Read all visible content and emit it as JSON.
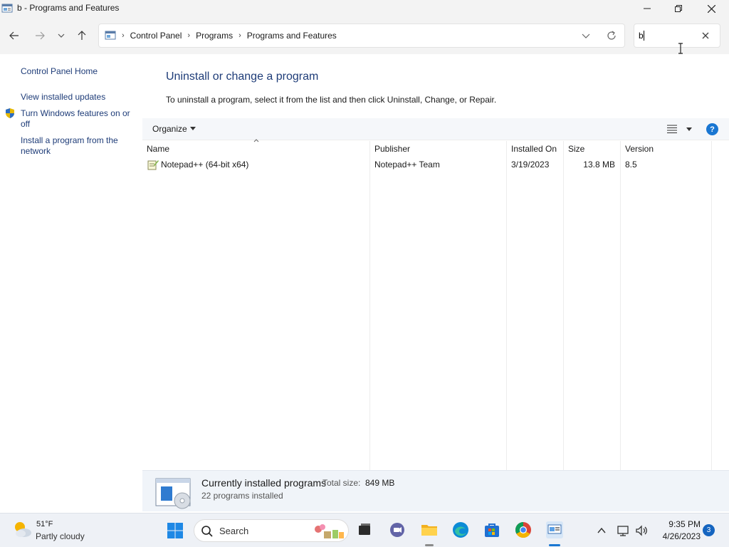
{
  "window": {
    "title": "b - Programs and Features",
    "icon": "control-panel-icon",
    "controls": [
      "minimize-icon",
      "maximize-icon",
      "close-icon"
    ]
  },
  "navigation": {
    "breadcrumbs": [
      "Control Panel",
      "Programs",
      "Programs and Features"
    ],
    "search_value": "b"
  },
  "sidebar": {
    "links": [
      {
        "label": "Control Panel Home"
      },
      {
        "label": "View installed updates"
      },
      {
        "label": "Turn Windows features on or off",
        "icon": "uac-shield-icon"
      },
      {
        "label": "Install a program from the network"
      }
    ]
  },
  "main": {
    "heading": "Uninstall or change a program",
    "instructions": "To uninstall a program, select it from the list and then click Uninstall, Change, or Repair.",
    "toolbar": {
      "organize_label": "Organize",
      "help_label": "?"
    },
    "columns": [
      "Name",
      "Publisher",
      "Installed On",
      "Size",
      "Version"
    ],
    "programs": [
      {
        "name": "Notepad++ (64-bit x64)",
        "publisher": "Notepad++ Team",
        "installed_on": "3/19/2023",
        "size": "13.8 MB",
        "version": "8.5"
      }
    ]
  },
  "details": {
    "title": "Currently installed programs",
    "total_size_label": "Total size:",
    "total_size_value": "849 MB",
    "count_text": "22 programs installed"
  },
  "taskbar": {
    "weather_temp": "51°F",
    "weather_condition": "Partly cloudy",
    "search_label": "Search",
    "apps": [
      "start-icon",
      "task-view-icon",
      "teams-chat-icon",
      "file-explorer-icon",
      "edge-icon",
      "microsoft-store-icon",
      "chrome-icon",
      "control-panel-icon"
    ],
    "clock_time": "9:35 PM",
    "clock_date": "4/26/2023",
    "notification_count": "3"
  },
  "colors": {
    "link_blue": "#1e3c78",
    "accent": "#1976d2",
    "chrome_bg": "#f3f3f3",
    "details_bg": "#f0f4f9"
  }
}
